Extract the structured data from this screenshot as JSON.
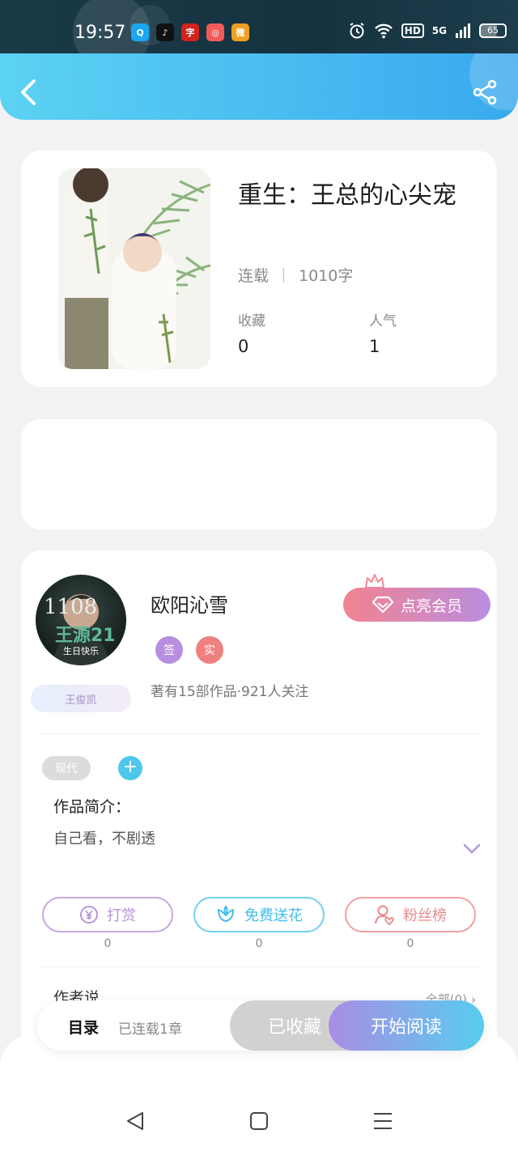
{
  "status_bar": {
    "time": "19:57",
    "apps": [
      {
        "name": "qq-icon",
        "glyph": "Q",
        "color": "#1aa7f0"
      },
      {
        "name": "tiktok-icon",
        "glyph": "♪",
        "color": "#111111"
      },
      {
        "name": "news-icon",
        "glyph": "字",
        "color": "#d2231d"
      },
      {
        "name": "app-icon",
        "glyph": "◎",
        "color": "#f05a5a"
      },
      {
        "name": "weibo-icon",
        "glyph": "微",
        "color": "#f0a020"
      }
    ],
    "network": "HD",
    "signal": "5G",
    "battery": "65"
  },
  "book": {
    "title": "重生：王总的心尖宠",
    "status": "连载",
    "word_count": "1010字",
    "favorites_label": "收藏",
    "favorites_value": "0",
    "popularity_label": "人气",
    "popularity_value": "1"
  },
  "author": {
    "name": "欧阳沁雪",
    "badge_signed": "签",
    "badge_real": "实",
    "info": "著有15部作品·921人关注",
    "fan_tag": "王俊凯",
    "avatar_text_top": "1108",
    "avatar_text_mid": "王源21",
    "avatar_text_bottom": "生日快乐",
    "vip_button": "点亮会员"
  },
  "tags": {
    "genre": "现代",
    "add": "+"
  },
  "intro": {
    "label": "作品简介：",
    "text": "自己看，不剧透"
  },
  "actions": [
    {
      "label": "打赏",
      "count": "0",
      "color": "#b794dc"
    },
    {
      "label": "免费送花",
      "count": "0",
      "color": "#4fc7ec"
    },
    {
      "label": "粉丝榜",
      "count": "0",
      "color": "#ec8a8a"
    }
  ],
  "author_says": {
    "label": "作者说",
    "all": "全部(0)"
  },
  "bottom_bar": {
    "toc": "目录",
    "toc_sub": "已连载1章",
    "collected": "已收藏",
    "read": "开始阅读"
  }
}
